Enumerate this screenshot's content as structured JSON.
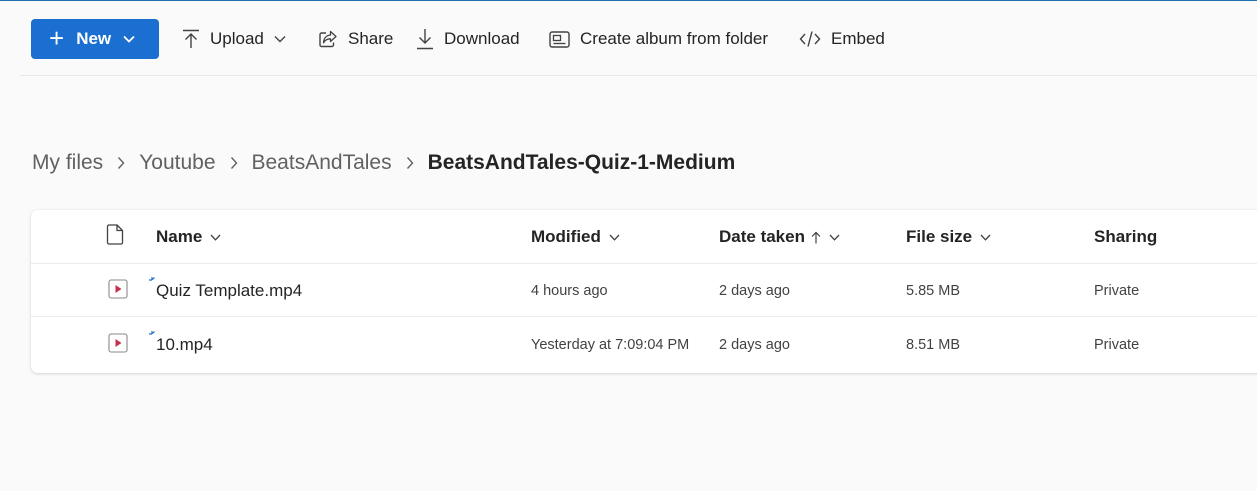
{
  "toolbar": {
    "new_label": "New",
    "upload_label": "Upload",
    "share_label": "Share",
    "download_label": "Download",
    "album_label": "Create album from folder",
    "embed_label": "Embed"
  },
  "breadcrumb": {
    "items": [
      "My files",
      "Youtube",
      "BeatsAndTales"
    ],
    "current": "BeatsAndTales-Quiz-1-Medium"
  },
  "table": {
    "columns": {
      "name": "Name",
      "modified": "Modified",
      "date_taken": "Date taken",
      "file_size": "File size",
      "sharing": "Sharing"
    },
    "rows": [
      {
        "name": "Quiz Template.mp4",
        "modified": "4 hours ago",
        "date_taken": "2 days ago",
        "file_size": "5.85 MB",
        "sharing": "Private"
      },
      {
        "name": "10.mp4",
        "modified": "Yesterday at 7:09:04 PM",
        "date_taken": "2 days ago",
        "file_size": "8.51 MB",
        "sharing": "Private"
      }
    ]
  },
  "icons": {
    "file_type": "video-file-icon",
    "new_indicator": "new-file-sparkle-icon"
  },
  "colors": {
    "accent": "#1a6fd0",
    "video_icon": "#c4314b"
  }
}
